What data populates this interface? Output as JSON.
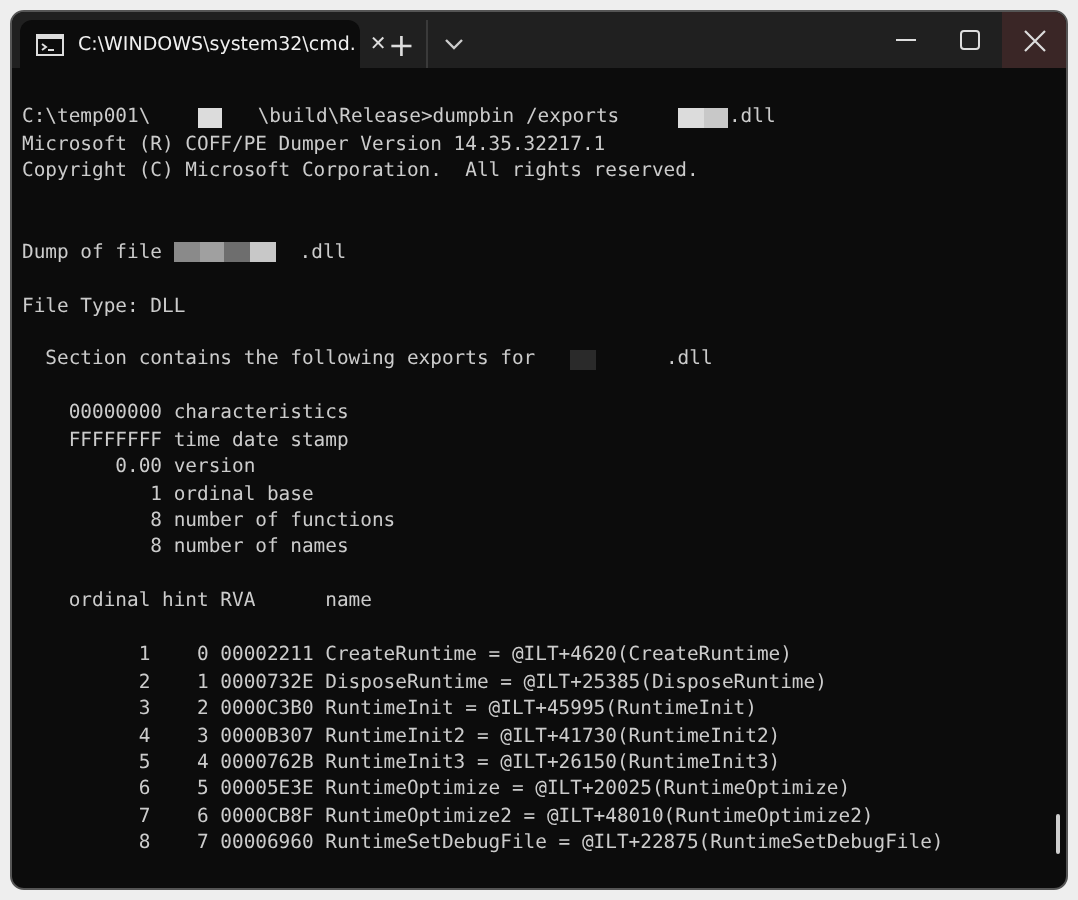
{
  "tabs": [
    {
      "title": "C:\\WINDOWS\\system32\\cmd.",
      "close": "✕",
      "selected": true
    }
  ],
  "new_tab": "+",
  "lines": [
    {
      "kind": "blank"
    },
    {
      "kind": "text",
      "parts": [
        {
          "kind": "text",
          "text": "C:\\temp001\\    "
        },
        {
          "kind": "redacted",
          "color": "#dcdcdc"
        },
        {
          "kind": "text",
          "text": "   \\build\\Release>dumpbin /exports     "
        },
        {
          "kind": "redacted",
          "color": "#dcdcdc"
        },
        {
          "kind": "redacted",
          "color": "#c8c8c8"
        },
        {
          "kind": "text",
          "text": ".dll"
        }
      ]
    },
    {
      "kind": "text",
      "parts": [
        {
          "kind": "text",
          "text": "Microsoft (R) COFF/PE Dumper Version 14.35.32217.1"
        }
      ]
    },
    {
      "kind": "text",
      "parts": [
        {
          "kind": "text",
          "text": "Copyright (C) Microsoft Corporation.  All rights reserved."
        }
      ]
    },
    {
      "kind": "blank"
    },
    {
      "kind": "blank"
    },
    {
      "kind": "text",
      "parts": [
        {
          "kind": "text",
          "text": "Dump of file "
        },
        {
          "kind": "redacted",
          "color": "#8a8a8a"
        },
        {
          "kind": "redacted",
          "color": "#a0a0a0"
        },
        {
          "kind": "redacted",
          "color": "#6e6e6e"
        },
        {
          "kind": "redacted",
          "color": "#c8c8c8"
        },
        {
          "kind": "text",
          "text": "  .dll"
        }
      ]
    },
    {
      "kind": "blank"
    },
    {
      "kind": "text",
      "parts": [
        {
          "kind": "text",
          "text": "File Type: DLL"
        }
      ]
    },
    {
      "kind": "blank"
    },
    {
      "kind": "text",
      "parts": [
        {
          "kind": "text",
          "text": "  Section contains the following exports for   "
        },
        {
          "kind": "redacted",
          "color": "#2a2a2a"
        },
        {
          "kind": "text",
          "text": "      .dll"
        }
      ]
    },
    {
      "kind": "blank"
    },
    {
      "kind": "text",
      "parts": [
        {
          "kind": "text",
          "text": "    00000000 characteristics"
        }
      ]
    },
    {
      "kind": "text",
      "parts": [
        {
          "kind": "text",
          "text": "    FFFFFFFF time date stamp"
        }
      ]
    },
    {
      "kind": "text",
      "parts": [
        {
          "kind": "text",
          "text": "        0.00 version"
        }
      ]
    },
    {
      "kind": "text",
      "parts": [
        {
          "kind": "text",
          "text": "           1 ordinal base"
        }
      ]
    },
    {
      "kind": "text",
      "parts": [
        {
          "kind": "text",
          "text": "           8 number of functions"
        }
      ]
    },
    {
      "kind": "text",
      "parts": [
        {
          "kind": "text",
          "text": "           8 number of names"
        }
      ]
    },
    {
      "kind": "blank"
    },
    {
      "kind": "text",
      "parts": [
        {
          "kind": "text",
          "text": "    ordinal hint RVA      name"
        }
      ]
    },
    {
      "kind": "blank"
    },
    {
      "kind": "text",
      "parts": [
        {
          "kind": "text",
          "text": "          1    0 00002211 CreateRuntime = @ILT+4620(CreateRuntime)"
        }
      ]
    },
    {
      "kind": "text",
      "parts": [
        {
          "kind": "text",
          "text": "          2    1 0000732E DisposeRuntime = @ILT+25385(DisposeRuntime)"
        }
      ]
    },
    {
      "kind": "text",
      "parts": [
        {
          "kind": "text",
          "text": "          3    2 0000C3B0 RuntimeInit = @ILT+45995(RuntimeInit)"
        }
      ]
    },
    {
      "kind": "text",
      "parts": [
        {
          "kind": "text",
          "text": "          4    3 0000B307 RuntimeInit2 = @ILT+41730(RuntimeInit2)"
        }
      ]
    },
    {
      "kind": "text",
      "parts": [
        {
          "kind": "text",
          "text": "          5    4 0000762B RuntimeInit3 = @ILT+26150(RuntimeInit3)"
        }
      ]
    },
    {
      "kind": "text",
      "parts": [
        {
          "kind": "text",
          "text": "          6    5 00005E3E RuntimeOptimize = @ILT+20025(RuntimeOptimize)"
        }
      ]
    },
    {
      "kind": "text",
      "parts": [
        {
          "kind": "text",
          "text": "          7    6 0000CB8F RuntimeOptimize2 = @ILT+48010(RuntimeOptimize2)"
        }
      ]
    },
    {
      "kind": "text",
      "parts": [
        {
          "kind": "text",
          "text": "          8    7 00006960 RuntimeSetDebugFile = @ILT+22875(RuntimeSetDebugFile)"
        }
      ]
    }
  ]
}
